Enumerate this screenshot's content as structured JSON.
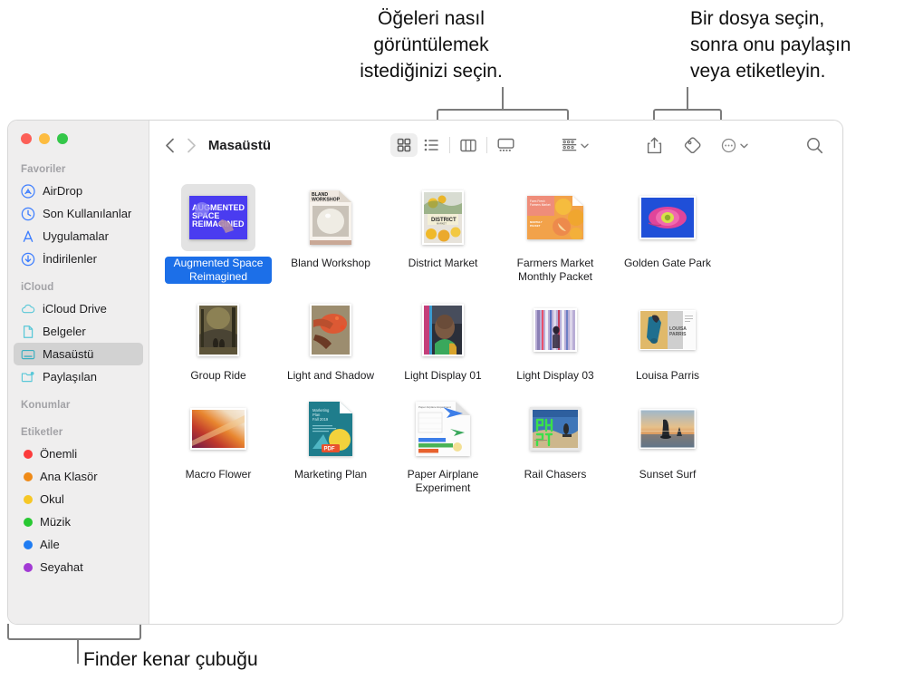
{
  "callouts": {
    "view_modes": "Öğeleri nasıl\ngörüntülemek\nistediğinizi seçin.",
    "share_tag": "Bir dosya seçin,\nsonra onu paylaşın\nveya etiketleyin.",
    "sidebar": "Finder kenar çubuğu"
  },
  "window": {
    "traffic_lights": {
      "close": "close-button",
      "minimize": "minimize-button",
      "zoom": "zoom-button",
      "close_color": "#fc5f57",
      "minimize_color": "#fdbc40",
      "zoom_color": "#34c749"
    }
  },
  "sidebar": {
    "sections": [
      {
        "header": "Favoriler",
        "items": [
          {
            "label": "AirDrop",
            "icon": "airdrop-icon",
            "color": "#3d7eff",
            "selected": false
          },
          {
            "label": "Son Kullanılanlar",
            "icon": "recents-clock-icon",
            "color": "#3d7eff",
            "selected": false
          },
          {
            "label": "Uygulamalar",
            "icon": "applications-icon",
            "color": "#3d7eff",
            "selected": false
          },
          {
            "label": "İndirilenler",
            "icon": "downloads-icon",
            "color": "#3d7eff",
            "selected": false
          }
        ]
      },
      {
        "header": "iCloud",
        "items": [
          {
            "label": "iCloud Drive",
            "icon": "icloud-drive-icon",
            "color": "#5ac8d8",
            "selected": false
          },
          {
            "label": "Belgeler",
            "icon": "documents-icon",
            "color": "#5ac8d8",
            "selected": false
          },
          {
            "label": "Masaüstü",
            "icon": "desktop-icon",
            "color": "#3aafc0",
            "selected": true
          },
          {
            "label": "Paylaşılan",
            "icon": "shared-folder-icon",
            "color": "#5ac8d8",
            "selected": false
          }
        ]
      },
      {
        "header": "Konumlar",
        "items": []
      },
      {
        "header": "Etiketler",
        "items": [
          {
            "label": "Önemli",
            "icon": "tag-dot-icon",
            "color": "#fc3b3b",
            "selected": false
          },
          {
            "label": "Ana Klasör",
            "icon": "tag-dot-icon",
            "color": "#ef8a17",
            "selected": false
          },
          {
            "label": "Okul",
            "icon": "tag-dot-icon",
            "color": "#f6c726",
            "selected": false
          },
          {
            "label": "Müzik",
            "icon": "tag-dot-icon",
            "color": "#28c832",
            "selected": false
          },
          {
            "label": "Aile",
            "icon": "tag-dot-icon",
            "color": "#1f7cf2",
            "selected": false
          },
          {
            "label": "Seyahat",
            "icon": "tag-dot-icon",
            "color": "#a23ad4",
            "selected": false
          }
        ]
      }
    ]
  },
  "toolbar": {
    "back": "back-chevron",
    "forward": "forward-chevron",
    "title": "Masaüstü",
    "view_modes": [
      {
        "name": "icon-view",
        "label": "Simge görünümü",
        "active": true
      },
      {
        "name": "list-view",
        "label": "Liste görünümü",
        "active": false
      },
      {
        "name": "column-view",
        "label": "Sütun görünümü",
        "active": false
      },
      {
        "name": "gallery-view",
        "label": "Galeri görünümü",
        "active": false
      }
    ],
    "group_by": "Grupla",
    "share": "Paylaş",
    "tags": "Etiketler",
    "more": "Daha Fazla",
    "search": "Ara"
  },
  "files": [
    {
      "name": "Augmented Space Reimagined",
      "kind": "keynote-thumb",
      "selected": true
    },
    {
      "name": "Bland Workshop",
      "kind": "pages-doc-thumb",
      "selected": false
    },
    {
      "name": "District Market",
      "kind": "photo-portrait-citrus",
      "selected": false
    },
    {
      "name": "Farmers Market Monthly Packet",
      "kind": "pages-doc-citrus",
      "selected": false
    },
    {
      "name": "Golden Gate Park",
      "kind": "photo-flower",
      "selected": false
    },
    {
      "name": "Group Ride",
      "kind": "photo-forest-portrait",
      "selected": false
    },
    {
      "name": "Light and Shadow",
      "kind": "photo-hands-portrait",
      "selected": false
    },
    {
      "name": "Light Display 01",
      "kind": "photo-portrait-person",
      "selected": false
    },
    {
      "name": "Light Display 03",
      "kind": "photo-stripes",
      "selected": false
    },
    {
      "name": "Louisa Parris",
      "kind": "photo-landscape-fashion",
      "selected": false
    },
    {
      "name": "Macro Flower",
      "kind": "photo-gradient",
      "selected": false
    },
    {
      "name": "Marketing Plan",
      "kind": "pdf-doc-thumb",
      "selected": false
    },
    {
      "name": "Paper Airplane Experiment",
      "kind": "numbers-doc-thumb",
      "selected": false
    },
    {
      "name": "Rail Chasers",
      "kind": "photo-graffiti",
      "selected": false
    },
    {
      "name": "Sunset Surf",
      "kind": "photo-sunset",
      "selected": false
    }
  ]
}
